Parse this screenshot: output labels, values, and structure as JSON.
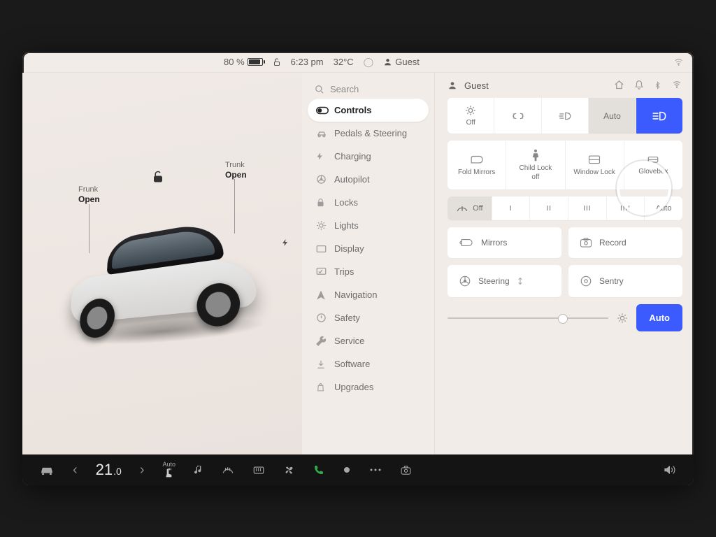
{
  "status": {
    "battery_pct": "80 %",
    "battery_fill_pct": 80,
    "time": "6:23 pm",
    "temp": "32°C",
    "user": "Guest"
  },
  "carpane": {
    "frunk_label": "Frunk",
    "frunk_state": "Open",
    "trunk_label": "Trunk",
    "trunk_state": "Open"
  },
  "menu": {
    "search": "Search",
    "items": [
      {
        "label": "Controls",
        "icon": "toggle"
      },
      {
        "label": "Pedals & Steering",
        "icon": "car"
      },
      {
        "label": "Charging",
        "icon": "bolt"
      },
      {
        "label": "Autopilot",
        "icon": "wheel"
      },
      {
        "label": "Locks",
        "icon": "lock"
      },
      {
        "label": "Lights",
        "icon": "light"
      },
      {
        "label": "Display",
        "icon": "display"
      },
      {
        "label": "Trips",
        "icon": "trips"
      },
      {
        "label": "Navigation",
        "icon": "nav"
      },
      {
        "label": "Safety",
        "icon": "safety"
      },
      {
        "label": "Service",
        "icon": "wrench"
      },
      {
        "label": "Software",
        "icon": "download"
      },
      {
        "label": "Upgrades",
        "icon": "bag"
      }
    ],
    "active_index": 0
  },
  "content": {
    "top": {
      "user": "Guest"
    },
    "lights": {
      "off": "Off",
      "auto": "Auto"
    },
    "tiles": {
      "fold_mirrors": "Fold Mirrors",
      "child_lock": "Child Lock",
      "child_lock_state": "off",
      "window_lock": "Window Lock",
      "glovebox": "Glovebox"
    },
    "wipers": {
      "off": "Off",
      "one": "I",
      "two": "II",
      "three": "III",
      "four": "IIII",
      "auto": "Auto"
    },
    "adjust": {
      "mirrors": "Mirrors",
      "steering": "Steering",
      "record": "Record",
      "sentry": "Sentry"
    },
    "brightness": {
      "auto": "Auto"
    }
  },
  "dock": {
    "temp": "21",
    "temp_decimal": ".0",
    "seat_mode": "Auto"
  }
}
